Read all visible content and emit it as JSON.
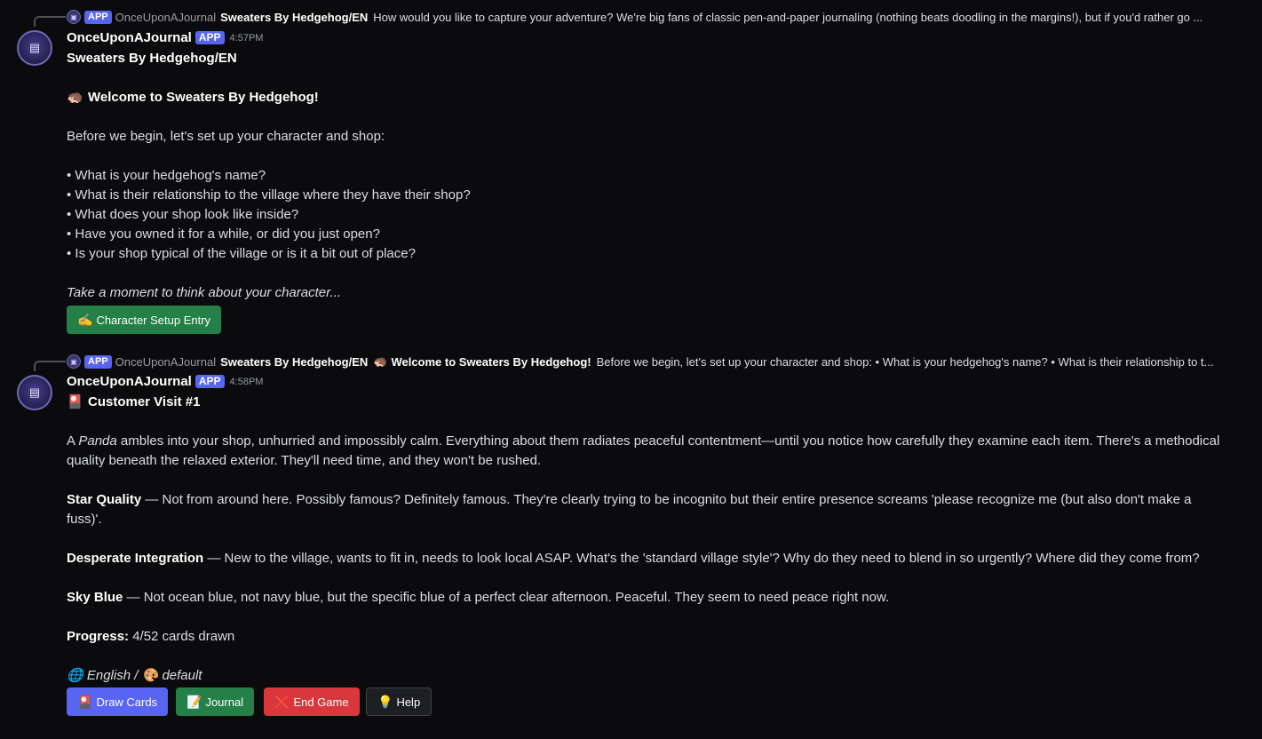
{
  "message1": {
    "reply": {
      "app_tag": "APP",
      "author": "OnceUponAJournal",
      "title": "Sweaters By Hedgehog/EN",
      "preview": "How would you like to capture your adventure? We're big fans of classic pen-and-paper journaling (nothing beats doodling in the margins!), but if you'd rather go ..."
    },
    "author": "OnceUponAJournal",
    "app_tag": "APP",
    "time": "4:57PM",
    "title": "Sweaters By Hedgehog/EN",
    "welcome_emoji": "🦔",
    "welcome": "Welcome to Sweaters By Hedgehog!",
    "intro": "Before we begin, let's set up your character and shop:",
    "questions": [
      "• What is your hedgehog's name?",
      "• What is their relationship to the village where they have their shop?",
      "• What does your shop look like inside?",
      "• Have you owned it for a while, or did you just open?",
      "• Is your shop typical of the village or is it a bit out of place?"
    ],
    "prompt": "Take a moment to think about your character...",
    "button": {
      "icon": "✍️",
      "label": "Character Setup Entry"
    }
  },
  "message2": {
    "reply": {
      "app_tag": "APP",
      "author": "OnceUponAJournal",
      "title": "Sweaters By Hedgehog/EN",
      "emoji": "🦔",
      "bold": "Welcome to Sweaters By Hedgehog!",
      "preview": "Before we begin, let's set up your character and shop:  • What is your hedgehog's name? • What is their relationship to t..."
    },
    "author": "OnceUponAJournal",
    "app_tag": "APP",
    "time": "4:58PM",
    "visit_emoji": "🎴",
    "visit_title": "Customer Visit #1",
    "desc_pre": "A ",
    "desc_animal": "Panda",
    "desc_post": " ambles into your shop, unhurried and impossibly calm. Everything about them radiates peaceful contentment—until you notice how carefully they examine each item. There's a methodical quality beneath the relaxed exterior. They'll need time, and they won't be rushed.",
    "traits": [
      {
        "name": "Star Quality",
        "text": " — Not from around here. Possibly famous? Definitely famous. They're clearly trying to be incognito but their entire presence screams 'please recognize me (but also don't make a fuss)'."
      },
      {
        "name": "Desperate Integration",
        "text": " — New to the village, wants to fit in, needs to look local ASAP. What's the 'standard village style'? Why do they need to blend in so urgently? Where did they come from?"
      },
      {
        "name": "Sky Blue",
        "text": " — Not ocean blue, not navy blue, but the specific blue of a perfect clear afternoon. Peaceful. They seem to need peace right now."
      }
    ],
    "progress_label": "Progress:",
    "progress_text": " 4/52 cards drawn",
    "language_icon": "🌐",
    "language": "English",
    "separator": " / ",
    "theme_icon": "🎨",
    "theme": "default",
    "buttons": [
      {
        "icon": "🎴",
        "label": "Draw Cards"
      },
      {
        "icon": "📝",
        "label": "Journal"
      },
      {
        "icon": "❌",
        "label": "End Game"
      },
      {
        "icon": "💡",
        "label": "Help"
      }
    ]
  }
}
